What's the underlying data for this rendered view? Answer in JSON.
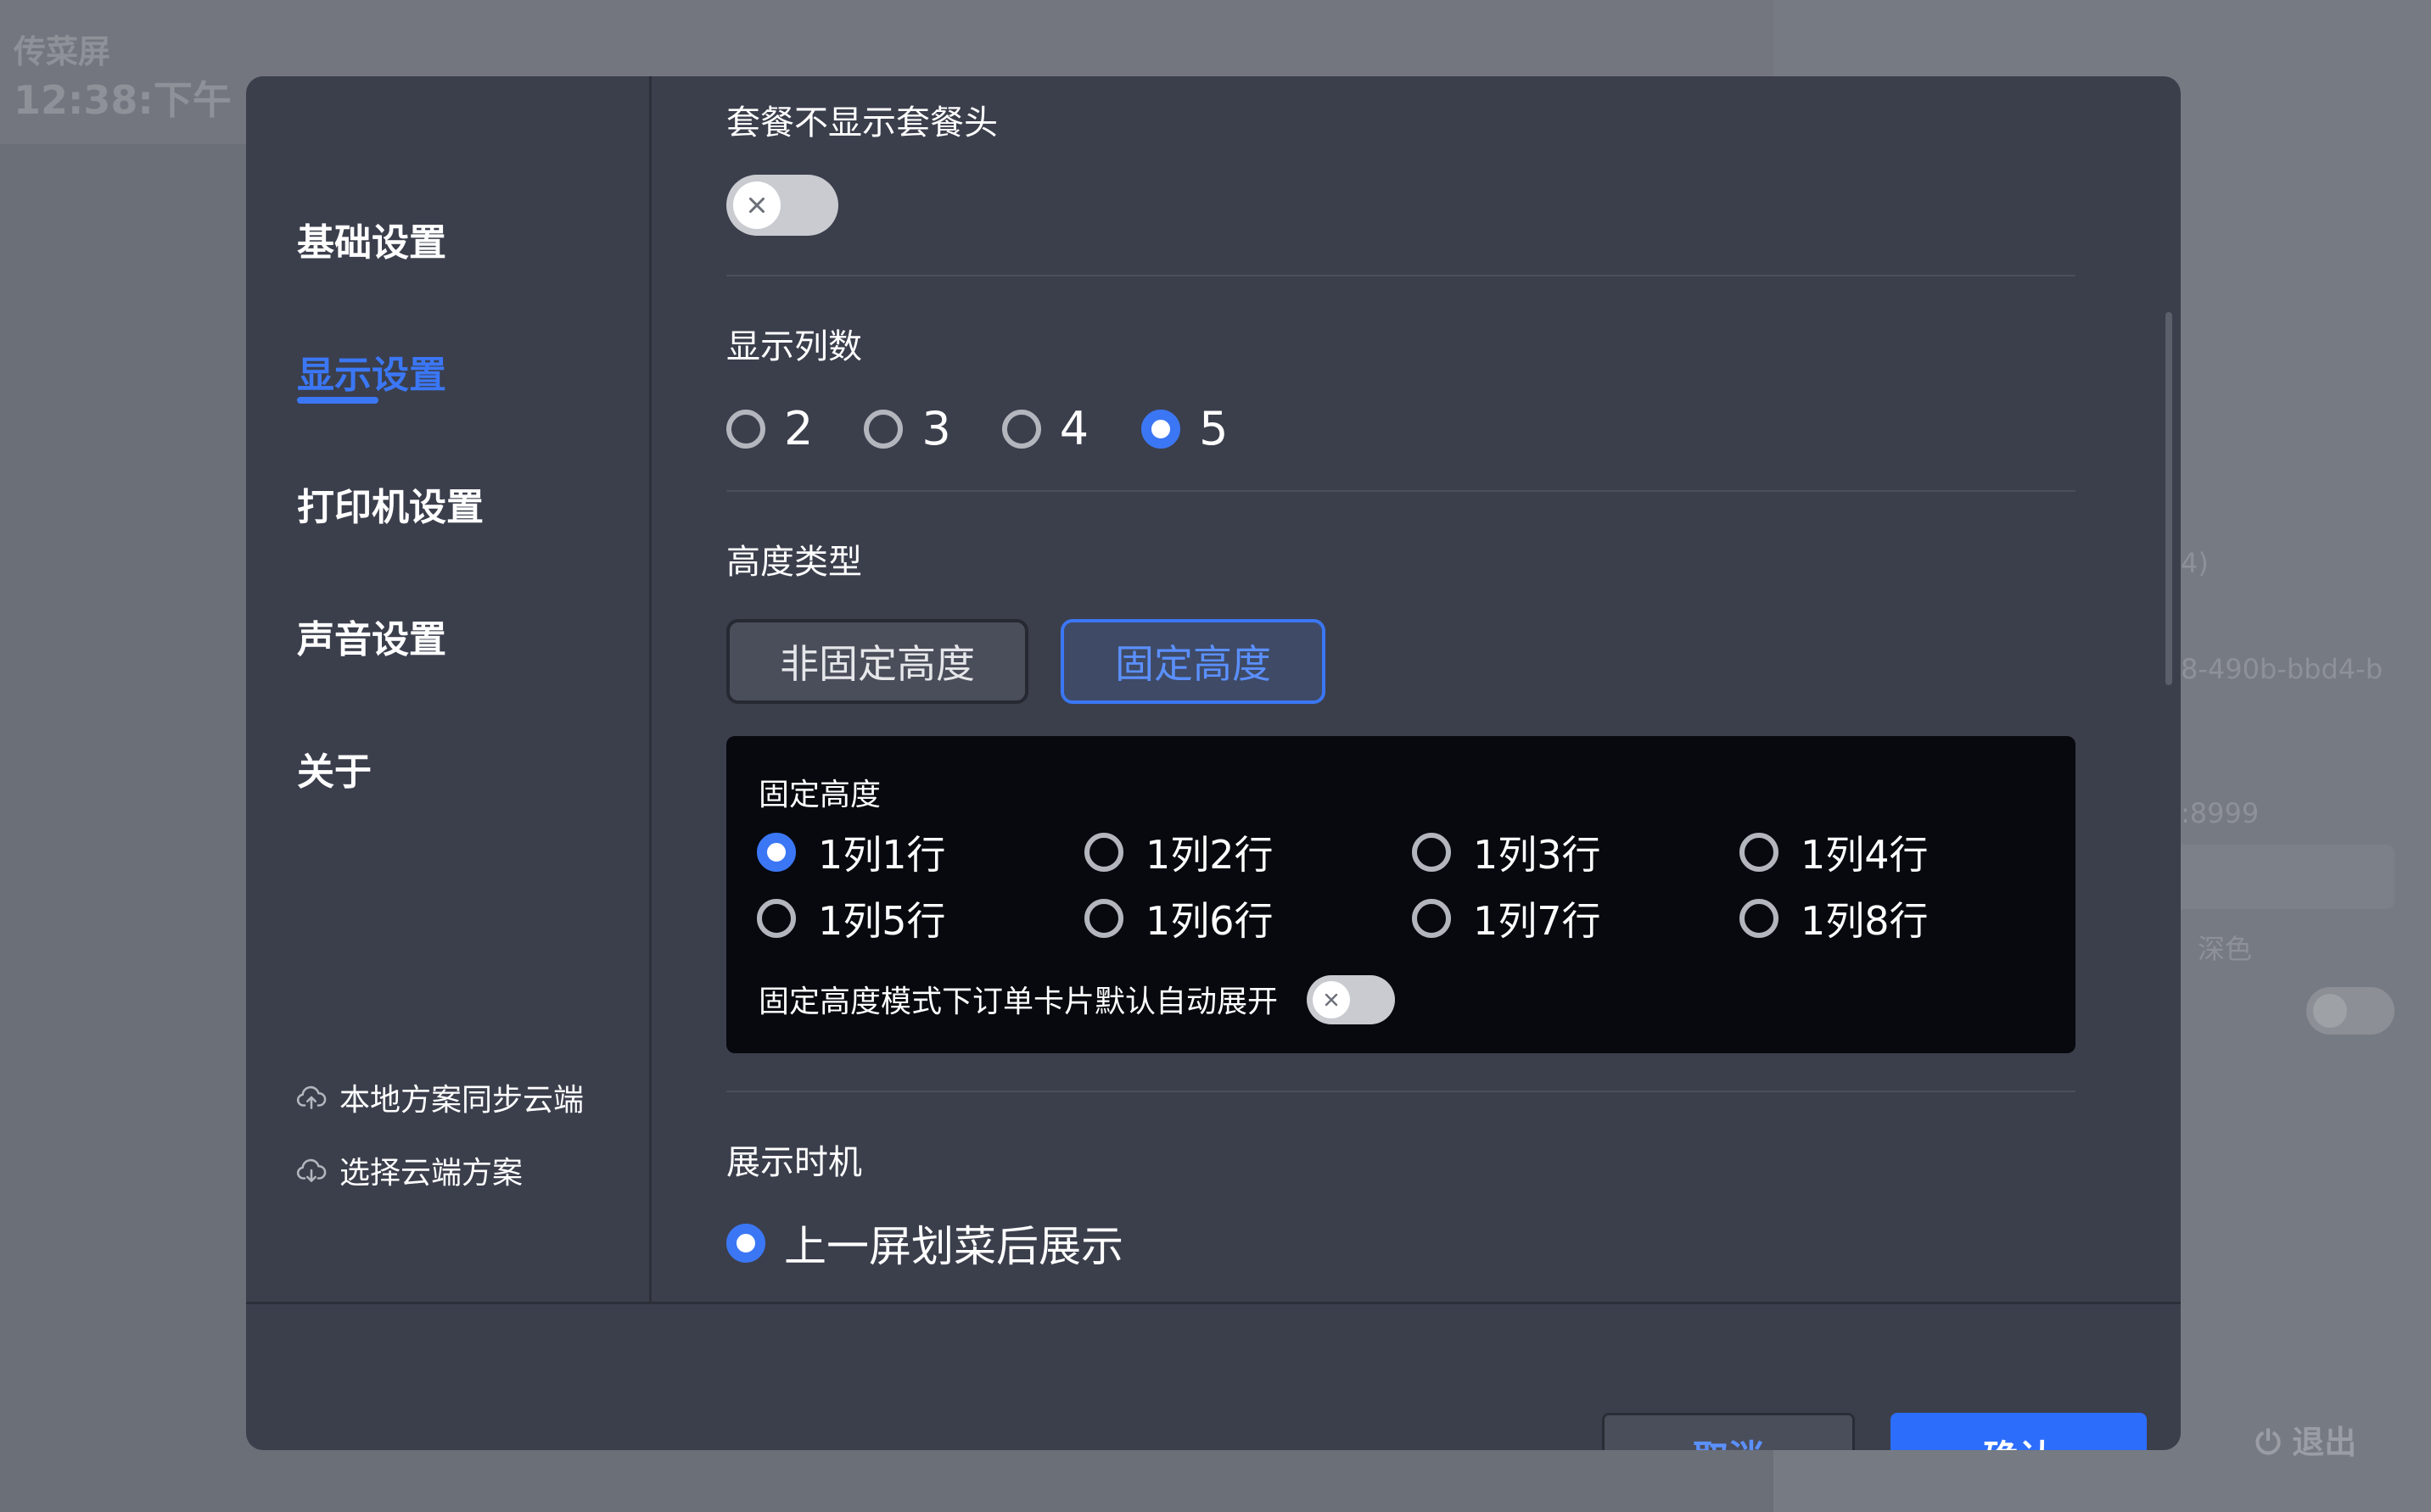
{
  "background": {
    "app_title": "传菜屏",
    "clock": "12:38:下午",
    "right_fragments": [
      "4)",
      "8-490b-bbd4-b",
      ":8999",
      "深色"
    ],
    "logout_label": "退出"
  },
  "sidebar": {
    "items": [
      {
        "label": "基础设置",
        "active": false
      },
      {
        "label": "显示设置",
        "active": true
      },
      {
        "label": "打印机设置",
        "active": false
      },
      {
        "label": "声音设置",
        "active": false
      },
      {
        "label": "关于",
        "active": false
      }
    ],
    "cloud_links": [
      {
        "label": "本地方案同步云端",
        "icon": "cloud-upload-icon"
      },
      {
        "label": "选择云端方案",
        "icon": "cloud-download-icon"
      }
    ]
  },
  "settings": {
    "combo_header": {
      "title": "套餐不显示套餐头",
      "enabled": false
    },
    "columns": {
      "title": "显示列数",
      "options": [
        "2",
        "3",
        "4",
        "5"
      ],
      "selected": "5"
    },
    "height_type": {
      "title": "高度类型",
      "options": [
        "非固定高度",
        "固定高度"
      ],
      "selected": "固定高度"
    },
    "fixed_height": {
      "title": "固定高度",
      "options": [
        "1列1行",
        "1列2行",
        "1列3行",
        "1列4行",
        "1列5行",
        "1列6行",
        "1列7行",
        "1列8行"
      ],
      "selected": "1列1行",
      "auto_expand_label": "固定高度模式下订单卡片默认自动展开",
      "auto_expand_enabled": false
    },
    "display_timing": {
      "title": "展示时机",
      "option": "上一屏划菜后展示",
      "selected": true
    }
  },
  "footer": {
    "cancel_label": "取消",
    "confirm_label": "确认"
  },
  "colors": {
    "accent": "#3b77f5",
    "modal_bg": "#3b3f4c",
    "panel_bg": "#07090f"
  }
}
